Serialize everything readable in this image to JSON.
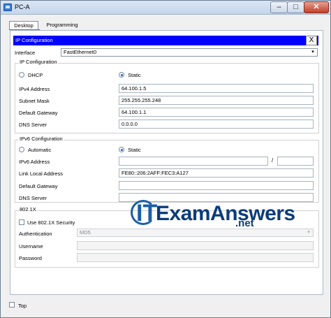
{
  "window": {
    "title": "PC-A"
  },
  "tabs": [
    {
      "label": "Desktop"
    },
    {
      "label": "Programming"
    }
  ],
  "panel": {
    "title": "IP Configuration",
    "close": "X"
  },
  "interface": {
    "label": "Interface",
    "value": "FastEthernet0"
  },
  "ipv4": {
    "section": "IP Configuration",
    "dhcp_label": "DHCP",
    "static_label": "Static",
    "mode": "Static",
    "address_label": "IPv4 Address",
    "address": "64.100.1.5",
    "mask_label": "Subnet Mask",
    "mask": "255.255.255.248",
    "gateway_label": "Default Gateway",
    "gateway": "64.100.1.1",
    "dns_label": "DNS Server",
    "dns": "0.0.0.0"
  },
  "ipv6": {
    "section": "IPv6 Configuration",
    "automatic_label": "Automatic",
    "static_label": "Static",
    "mode": "Static",
    "address_label": "IPv6 Address",
    "address": "",
    "prefix_sep": "/",
    "prefix": "",
    "link_local_label": "Link Local Address",
    "link_local": "FE80::206:2AFF:FEC3:A127",
    "gateway_label": "Default Gateway",
    "gateway": "",
    "dns_label": "DNS Server",
    "dns": ""
  },
  "dot1x": {
    "section": "802.1X",
    "use_label": "Use 802.1X Security",
    "use_checked": false,
    "auth_label": "Authentication",
    "auth_value": "MD5",
    "username_label": "Username",
    "username": "",
    "password_label": "Password",
    "password": ""
  },
  "watermark": {
    "it": "IT",
    "brand": "ExamAnswers",
    "tld": ".net"
  },
  "footer": {
    "top_label": "Top",
    "top_checked": false
  },
  "icons": {
    "app": "pc-icon",
    "close": "close-icon",
    "dropdown": "chevron-down-icon"
  }
}
